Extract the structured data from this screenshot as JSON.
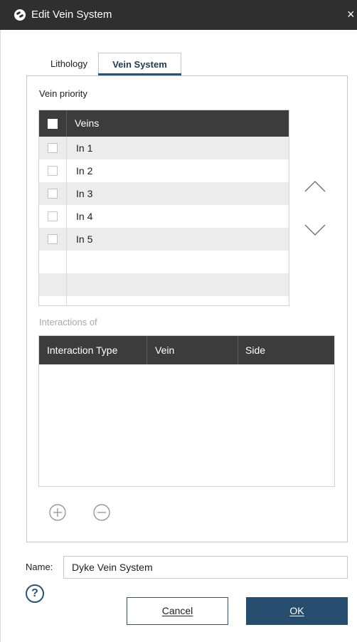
{
  "window": {
    "title": "Edit Vein System",
    "close_glyph": "×"
  },
  "tabs": [
    {
      "label": "Lithology",
      "active": false
    },
    {
      "label": "Vein System",
      "active": true
    }
  ],
  "vein_priority": {
    "label": "Vein priority",
    "column_header": "Veins",
    "rows": [
      {
        "name": "In 1",
        "checked": false
      },
      {
        "name": "In 2",
        "checked": false
      },
      {
        "name": "In 3",
        "checked": false
      },
      {
        "name": "In 4",
        "checked": false
      },
      {
        "name": "In 5",
        "checked": false
      }
    ],
    "move_up_icon": "chevron-up-icon",
    "move_down_icon": "chevron-down-icon"
  },
  "interactions": {
    "label": "Interactions of",
    "columns": [
      "Interaction Type",
      "Vein",
      "Side"
    ],
    "rows": [],
    "add_icon": "plus-circle-icon",
    "remove_icon": "minus-circle-icon"
  },
  "name_field": {
    "label": "Name:",
    "value": "Dyke Vein System"
  },
  "footer": {
    "help_glyph": "?",
    "cancel_label": "Cancel",
    "ok_label": "OK"
  },
  "colors": {
    "titlebar": "#2f2f2f",
    "table_header": "#3c3c3c",
    "accent": "#264d6e",
    "row_alt": "#ececec",
    "disabled_text": "#a8a8a8"
  }
}
